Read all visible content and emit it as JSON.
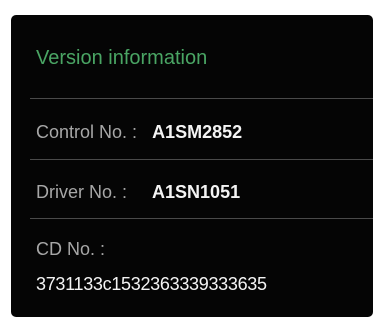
{
  "panel": {
    "title": "Version information",
    "title_color": "#4aa564",
    "control": {
      "label": "Control No. :",
      "value": "A1SM2852"
    },
    "driver": {
      "label": "Driver No. :",
      "value": "A1SN1051"
    },
    "cd": {
      "label": "CD No. :",
      "value": "3731133c1532363339333635"
    }
  }
}
